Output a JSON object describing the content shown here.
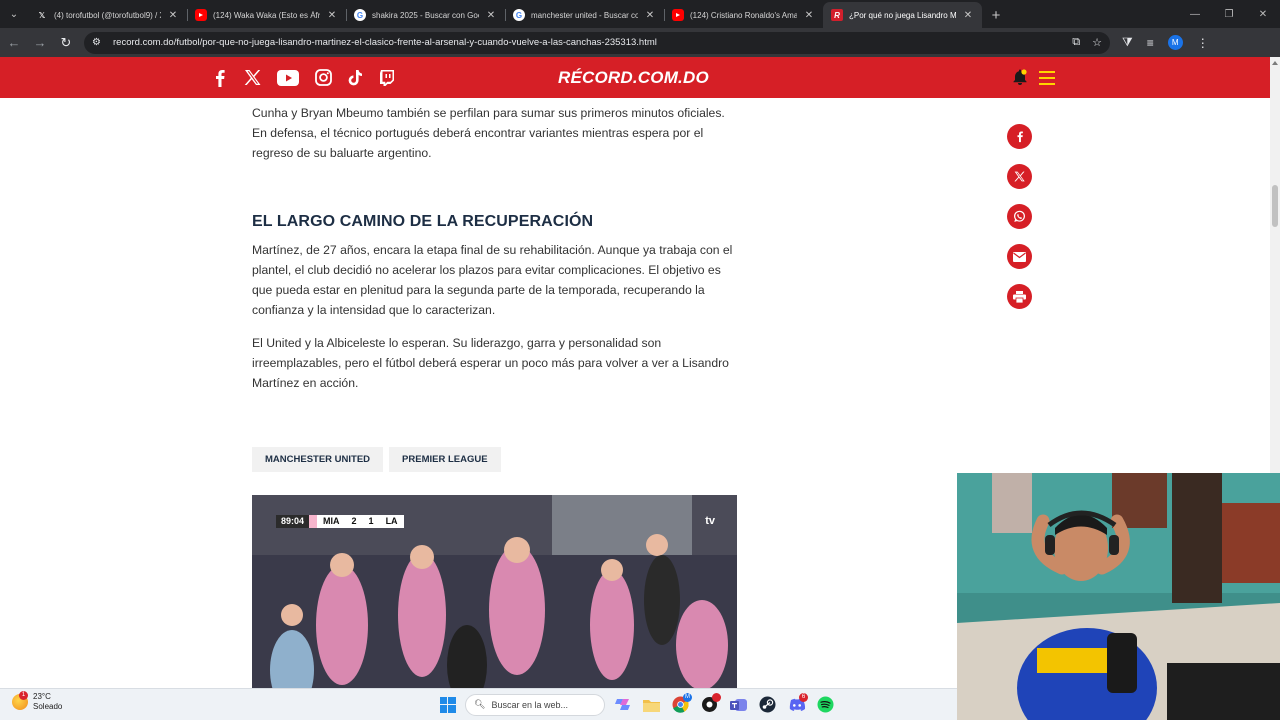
{
  "browser": {
    "tabs": [
      {
        "title": "(4) torofutbol (@torofutbol9) / X",
        "favicon": "x-icon",
        "active": false
      },
      {
        "title": "(124) Waka Waka (Esto es África)",
        "favicon": "youtube-icon",
        "active": false
      },
      {
        "title": "shakira 2025 - Buscar con Google",
        "favicon": "google-icon",
        "active": false
      },
      {
        "title": "manchester united - Buscar con Google",
        "favicon": "google-icon",
        "active": false
      },
      {
        "title": "(124) Cristiano Ronaldo's Amazing",
        "favicon": "youtube-icon",
        "active": false
      },
      {
        "title": "¿Por qué no juega Lisandro Martínez",
        "favicon": "record-icon",
        "active": true
      }
    ],
    "url": "record.com.do/futbol/por-que-no-juega-lisandro-martinez-el-clasico-frente-al-arsenal-y-cuando-vuelve-a-las-canchas-235313.html",
    "profile_initial": "M"
  },
  "site": {
    "logo": "RÉCORD.COM.DO",
    "brand_color": "#d61f26",
    "social_links": [
      "facebook-icon",
      "x-icon",
      "youtube-icon",
      "instagram-icon",
      "tiktok-icon",
      "twitch-icon"
    ]
  },
  "article": {
    "paragraph_1": "Cunha y Bryan Mbeumo también se perfilan para sumar sus primeros minutos oficiales. En defensa, el técnico portugués deberá encontrar variantes mientras espera por el regreso de su baluarte argentino.",
    "heading": "EL LARGO CAMINO DE LA RECUPERACIÓN",
    "paragraph_2": "Martínez, de 27 años, encara la etapa final de su rehabilitación. Aunque ya trabaja con el plantel, el club decidió no acelerar los plazos para evitar complicaciones. El objetivo es que pueda estar en plenitud para la segunda parte de la temporada, recuperando la confianza y la intensidad que lo caracterizan.",
    "paragraph_3": "El United y la Albiceleste lo esperan. Su liderazgo, garra y personalidad son irreemplazables, pero el fútbol deberá esperar un poco más para volver a ver a Lisandro Martínez en acción.",
    "tags": [
      "MANCHESTER UNITED",
      "PREMIER LEAGUE"
    ]
  },
  "video": {
    "clock": "89:04",
    "home_team": "MIA",
    "home_score": "2",
    "away_score": "1",
    "away_team": "LA",
    "network": "tv"
  },
  "share_buttons": [
    "facebook-share-icon",
    "x-share-icon",
    "whatsapp-share-icon",
    "email-share-icon",
    "print-share-icon"
  ],
  "taskbar": {
    "temperature": "23°C",
    "condition": "Soleado",
    "weather_badge": "1",
    "search_placeholder": "Buscar en la web...",
    "badges": {
      "chrome": "M",
      "unknown": "",
      "discord": "6"
    }
  }
}
